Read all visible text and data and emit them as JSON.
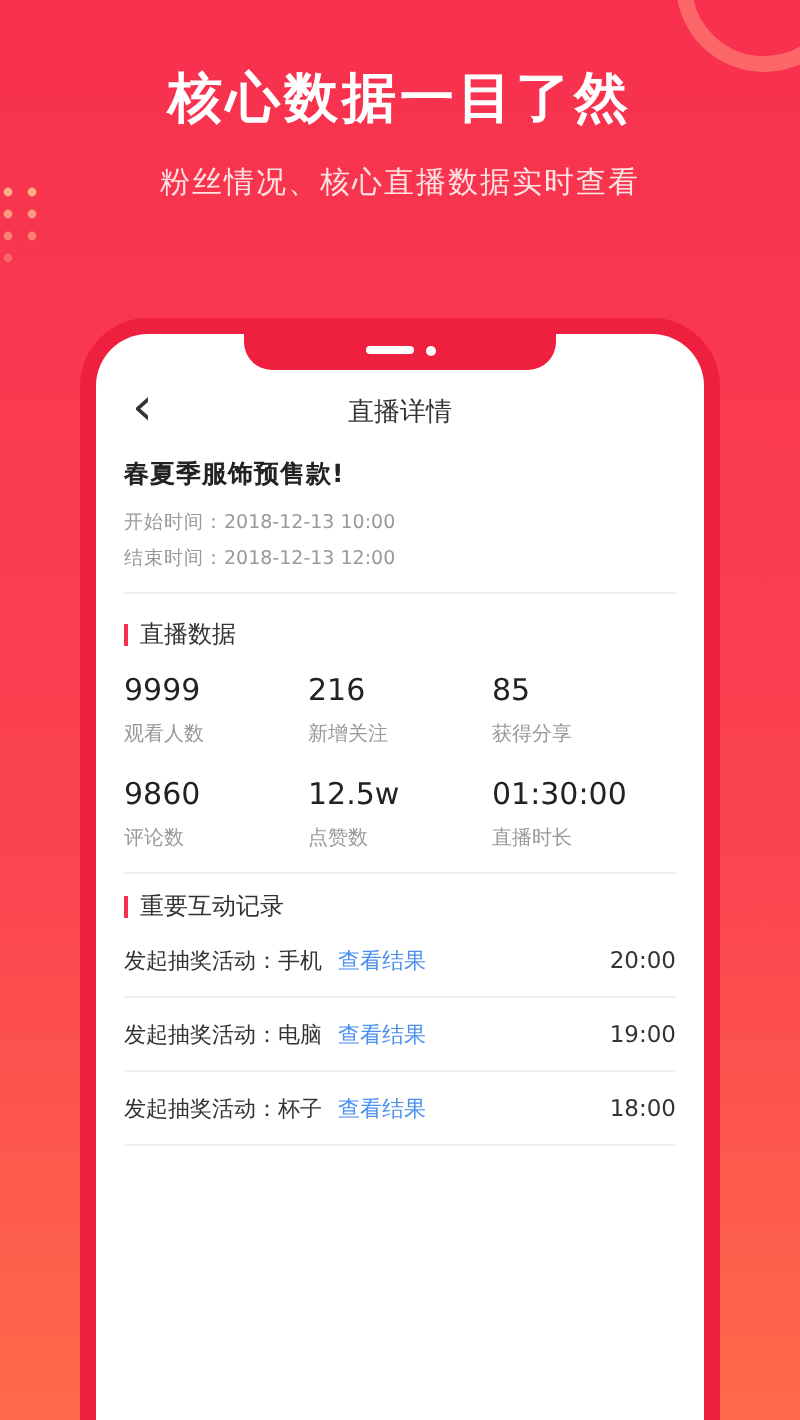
{
  "headline": "核心数据一目了然",
  "subheadline": "粉丝情况、核心直播数据实时查看",
  "screen": {
    "back_icon": "‹",
    "title": "直播详情",
    "event": {
      "name": "春夏季服饰预售款!",
      "start": "开始时间：2018-12-13 10:00",
      "end": "结束时间：2018-12-13 12:00"
    },
    "stats_section": {
      "title": "直播数据",
      "stats": [
        {
          "value": "9999",
          "label": "观看人数"
        },
        {
          "value": "216",
          "label": "新增关注"
        },
        {
          "value": "85",
          "label": "获得分享"
        },
        {
          "value": "9860",
          "label": "评论数"
        },
        {
          "value": "12.5w",
          "label": "点赞数"
        },
        {
          "value": "01:30:00",
          "label": "直播时长"
        }
      ]
    },
    "records_section": {
      "title": "重要互动记录",
      "records": [
        {
          "text": "发起抽奖活动：手机",
          "link": "查看结果",
          "time": "20:00"
        },
        {
          "text": "发起抽奖活动：电脑",
          "link": "查看结果",
          "time": "19:00"
        },
        {
          "text": "发起抽奖活动：杯子",
          "link": "查看结果",
          "time": "18:00"
        }
      ]
    }
  }
}
